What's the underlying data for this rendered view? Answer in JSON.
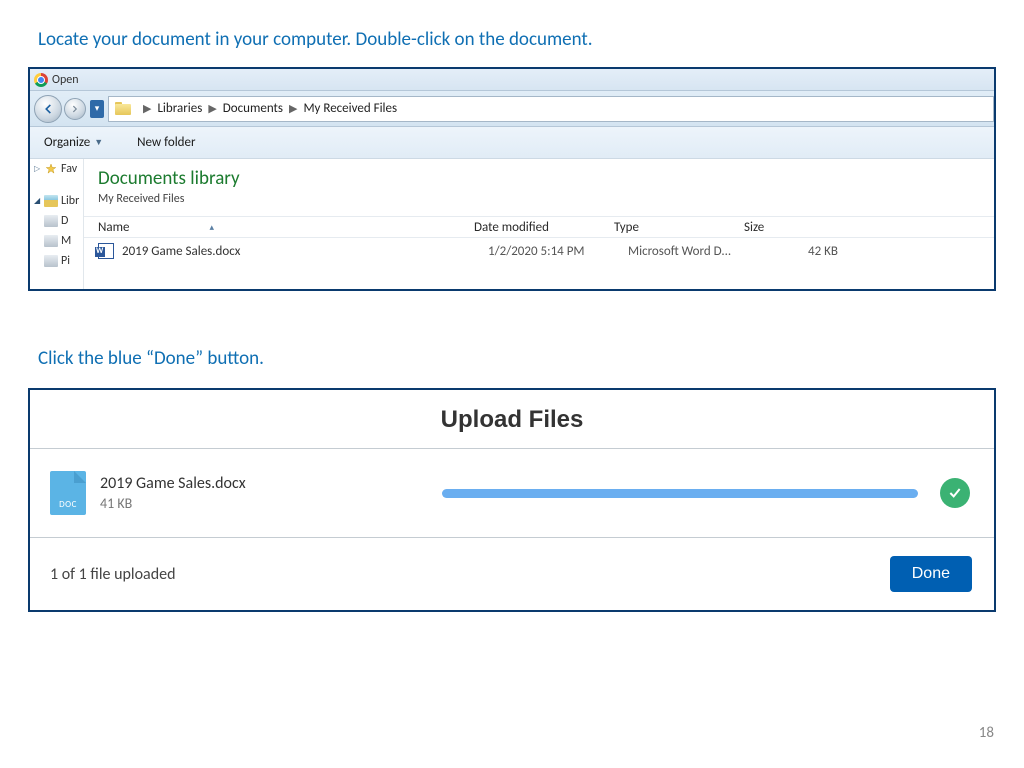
{
  "instruction_1": "Locate your document in your computer.  Double-click on the document.",
  "instruction_2": "Click the blue “Done” button.",
  "page_number": "18",
  "dialog": {
    "window_title": "Open",
    "breadcrumb": [
      "Libraries",
      "Documents",
      "My Received Files"
    ],
    "toolbar": {
      "organize": "Organize",
      "new_folder": "New folder"
    },
    "sidebar": {
      "favorites": "Fav",
      "libraries": "Libr",
      "item_d": "D",
      "item_m": "M",
      "item_pi": "Pi"
    },
    "library": {
      "title": "Documents library",
      "subtitle": "My Received Files"
    },
    "columns": {
      "name": "Name",
      "date": "Date modified",
      "type": "Type",
      "size": "Size"
    },
    "file": {
      "name": "2019 Game Sales.docx",
      "date": "1/2/2020 5:14 PM",
      "type": "Microsoft Word D...",
      "size": "42 KB"
    }
  },
  "upload": {
    "title": "Upload Files",
    "file_name": "2019 Game Sales.docx",
    "file_size": "41 KB",
    "doc_badge": "DOC",
    "status": "1 of 1 file uploaded",
    "done_label": "Done"
  }
}
